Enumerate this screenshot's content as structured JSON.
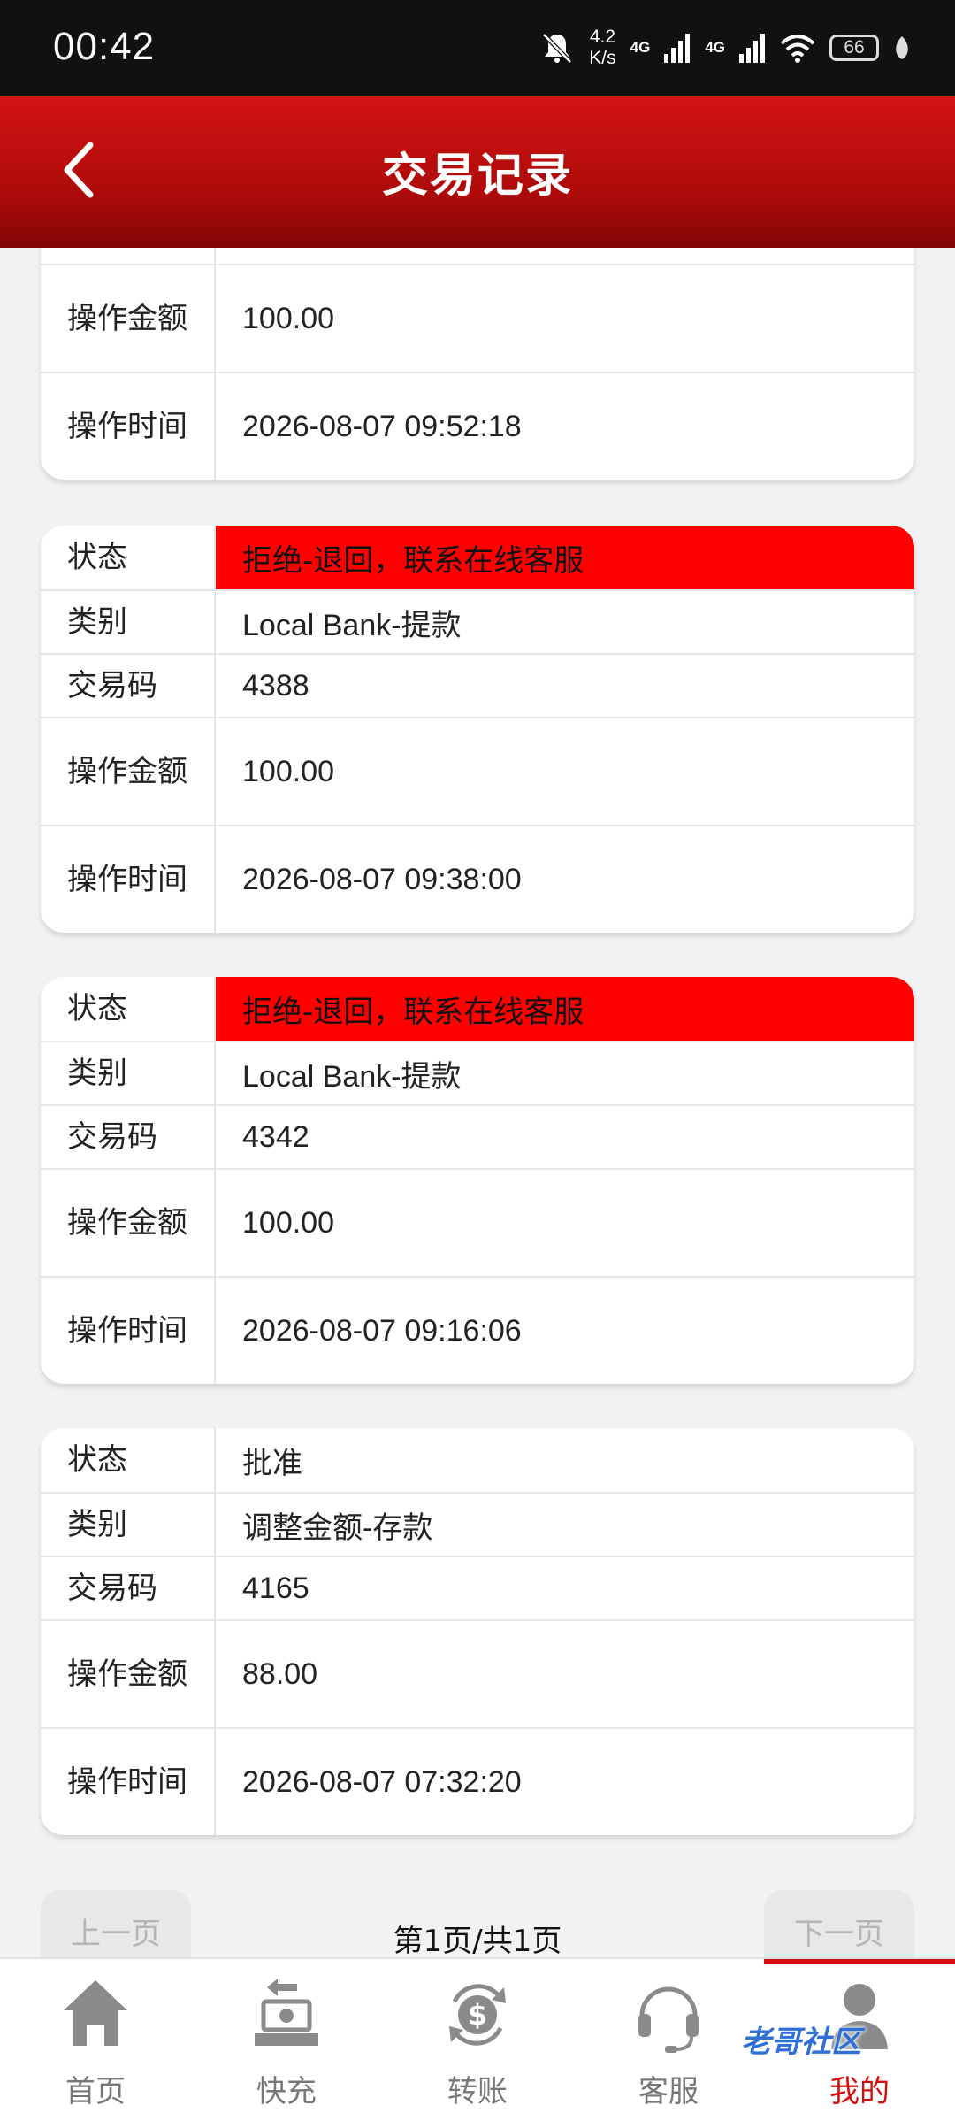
{
  "status_bar": {
    "time": "00:42",
    "speed_value": "4.2",
    "speed_unit": "K/s",
    "net1": "4G",
    "net2": "4G",
    "battery": "66"
  },
  "header": {
    "title": "交易记录"
  },
  "labels": {
    "status": "状态",
    "type": "类别",
    "code": "交易码",
    "amount": "操作金额",
    "time": "操作时间"
  },
  "records": [
    {
      "amount": "100.00",
      "time": "2026-08-07 09:52:18"
    },
    {
      "status": "拒绝-退回，联系在线客服",
      "type": "Local Bank-提款",
      "code": "4388",
      "amount": "100.00",
      "time": "2026-08-07 09:38:00"
    },
    {
      "status": "拒绝-退回，联系在线客服",
      "type": "Local Bank-提款",
      "code": "4342",
      "amount": "100.00",
      "time": "2026-08-07 09:16:06"
    },
    {
      "status": "批准",
      "type": "调整金额-存款",
      "code": "4165",
      "amount": "88.00",
      "time": "2026-08-07 07:32:20"
    }
  ],
  "pagination": {
    "prev": "上一页",
    "info": "第1页/共1页",
    "next": "下一页"
  },
  "nav": [
    {
      "label": "首页",
      "icon": "home-icon"
    },
    {
      "label": "快充",
      "icon": "quick-charge-icon"
    },
    {
      "label": "转账",
      "icon": "transfer-icon"
    },
    {
      "label": "客服",
      "icon": "headset-icon"
    },
    {
      "label": "我的",
      "icon": "user-icon"
    }
  ],
  "watermark": "老哥社区",
  "colors": {
    "header_red": "#c01010",
    "status_rejected_bg": "#ff0000",
    "nav_active": "#d30e0e"
  }
}
